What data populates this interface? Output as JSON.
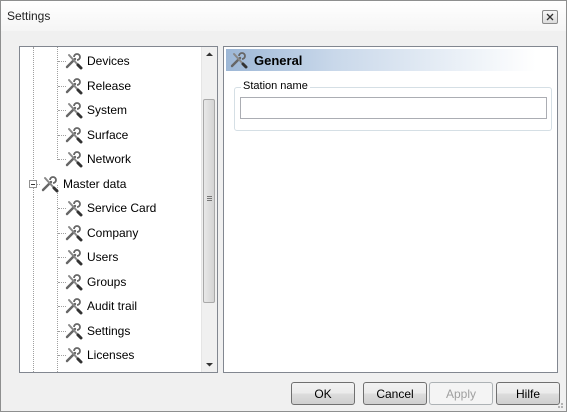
{
  "window": {
    "title": "Settings"
  },
  "tree": {
    "items": [
      {
        "label": "Devices",
        "level": 2
      },
      {
        "label": "Release",
        "level": 2
      },
      {
        "label": "System",
        "level": 2
      },
      {
        "label": "Surface",
        "level": 2
      },
      {
        "label": "Network",
        "level": 2
      },
      {
        "label": "Master data",
        "level": 1,
        "expanded": true
      },
      {
        "label": "Service Card",
        "level": 2
      },
      {
        "label": "Company",
        "level": 2
      },
      {
        "label": "Users",
        "level": 2
      },
      {
        "label": "Groups",
        "level": 2
      },
      {
        "label": "Audit trail",
        "level": 2
      },
      {
        "label": "Settings",
        "level": 2
      },
      {
        "label": "Licenses",
        "level": 2
      }
    ],
    "icon": "tools-icon"
  },
  "panel": {
    "header_title": "General",
    "icon": "tools-icon",
    "station_name_label": "Station name",
    "station_name_value": ""
  },
  "buttons": {
    "ok": "OK",
    "cancel": "Cancel",
    "apply": "Apply",
    "help": "Hilfe"
  },
  "colors": {
    "header_gradient_start": "#9db7d6",
    "border": "#828790"
  }
}
